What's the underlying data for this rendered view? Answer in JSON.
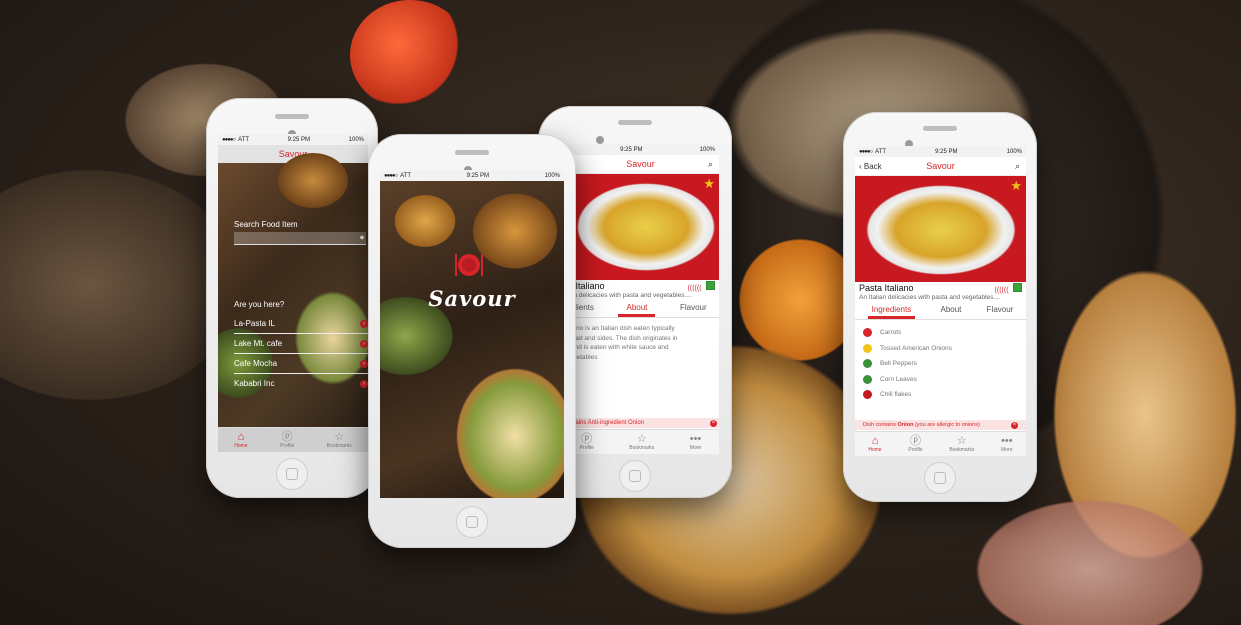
{
  "app": {
    "name": "Savour"
  },
  "status": {
    "carrier": "ATT",
    "time": "9:25 PM",
    "battery": "100%"
  },
  "search_screen": {
    "search_label": "Search Food Item",
    "location_question": "Are you here?",
    "places": [
      "La-Pasta IL",
      "Lake Mt. cafe",
      "Cafe Mocha",
      "Kababri Inc"
    ]
  },
  "tabs": [
    "Home",
    "Profile",
    "Bookmarks",
    "More"
  ],
  "dish": {
    "name": "Pasta Italiano",
    "spice": "((((((",
    "description_short": "An Italian delicacies with pasta and vegetables....",
    "about_text": "Pasta Italiano is an Italian dish eaten typically with bread and sides. The dish originates in Italy and is eaten with white sauce and vegetables",
    "about_visible_lines": [
      "aliano is an Italian dish eaten typically",
      "bread and sides. The dish originates in",
      "y and is eaten with white sauce and",
      "vegetables"
    ],
    "tabs": [
      "Ingredients",
      "About",
      "Flavour"
    ],
    "ingredients": [
      {
        "name": "Carrots",
        "color": "#d7262b"
      },
      {
        "name": "Tossed American Onions",
        "color": "#f0c419"
      },
      {
        "name": "Bell Peppers",
        "color": "#3d8f3a"
      },
      {
        "name": "Corn Leaves",
        "color": "#3d8f3a"
      },
      {
        "name": "Chili flakes",
        "color": "#c4191e"
      }
    ],
    "allergy_prefix": "Dish contains ",
    "allergy_item": "Onion",
    "allergy_suffix": " (you are allergic to onions)",
    "allergy_partial": "contains Anti-ingredient Onion"
  },
  "nav": {
    "back": "Back",
    "title": "Savour"
  },
  "colors": {
    "accent": "#d7262b"
  }
}
